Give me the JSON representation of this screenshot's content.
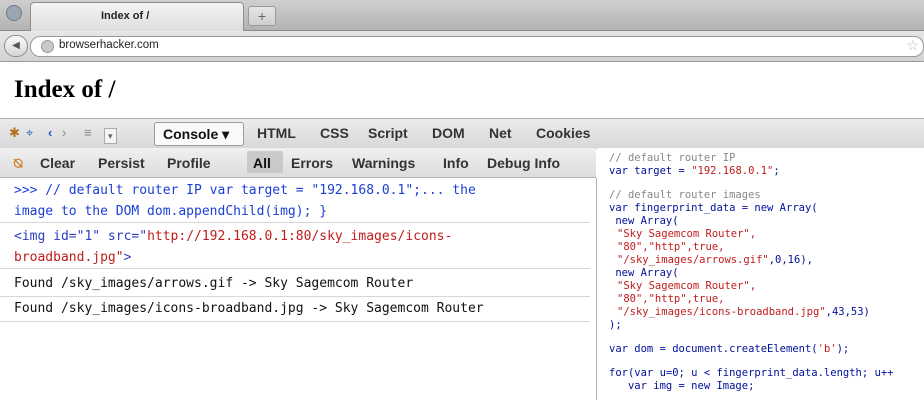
{
  "browser": {
    "tab_title": "Index of /",
    "new_tab_symbol": "+",
    "url": "browserhacker.com"
  },
  "page": {
    "heading": "Index of /"
  },
  "devtools": {
    "panel_selected": "Console ▾",
    "panel_tabs": [
      "HTML",
      "CSS",
      "Script",
      "DOM",
      "Net",
      "Cookies"
    ],
    "console_buttons": [
      "Clear",
      "Persist",
      "Profile",
      "All",
      "Errors",
      "Warnings",
      "Info",
      "Debug Info"
    ],
    "log": {
      "cmd_line1": ">>> // default router IP var target = \"192.168.0.1\";... the",
      "cmd_line2": "image to the DOM    dom.appendChild(img); }",
      "html_prefix": "<img id=\"1\" src=\"",
      "html_url": "http://192.168.0.1:80/sky_images/icons-",
      "html_url2": "broadband.jpg\"",
      "html_suffix": ">",
      "found1": "Found  /sky_images/arrows.gif -> Sky Sagemcom Router",
      "found2": "Found  /sky_images/icons-broadband.jpg -> Sky Sagemcom Router"
    },
    "code": {
      "l1": "// default router IP",
      "l2a": "var target = ",
      "l2b": "\"192.168.0.1\"",
      "l2c": ";",
      "l3": "// default router images",
      "l4": "var fingerprint_data = new Array(",
      "l5": " new Array(",
      "l6": "\"Sky Sagemcom Router\",",
      "l7": "\"80\",\"http\",true,",
      "l8a": "\"/sky_images/arrows.gif\"",
      "l8b": ",0,16),",
      "l9": " new Array(",
      "l10": "\"Sky Sagemcom Router\",",
      "l11": "\"80\",\"http\",true,",
      "l12a": "\"/sky_images/icons-broadband.jpg\"",
      "l12b": ",43,53)",
      "l13": ");",
      "l14a": "var dom = document.createElement(",
      "l14b": "'b'",
      "l14c": ");",
      "l15": "for(var u=0; u < fingerprint_data.length; u++",
      "l16": "   var img = new Image;"
    }
  }
}
